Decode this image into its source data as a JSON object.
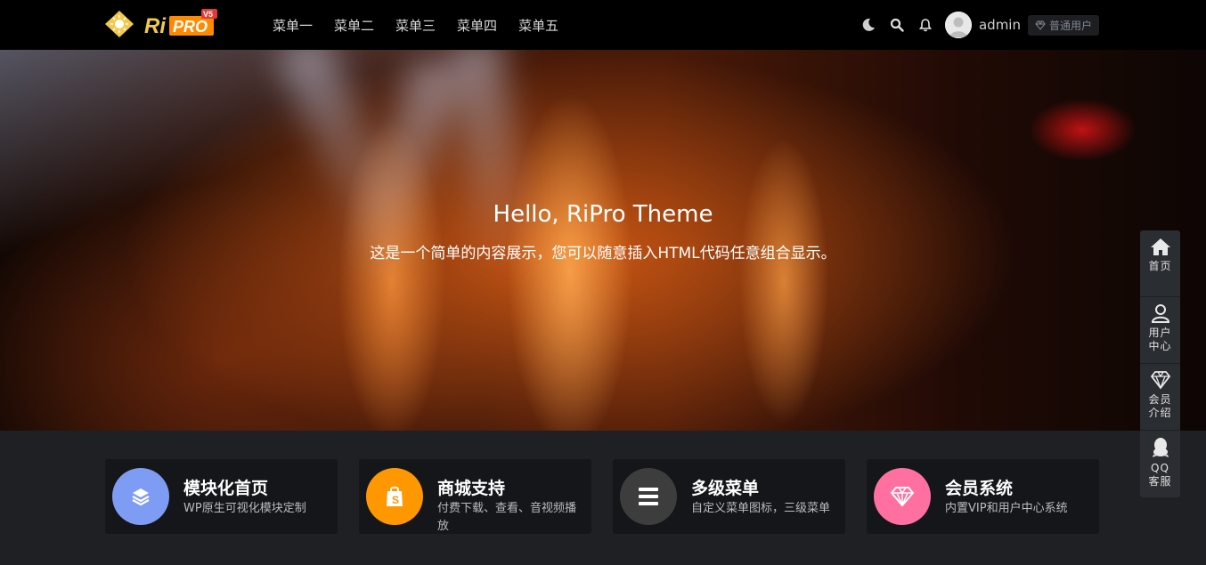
{
  "header": {
    "logo_text": "RiPRO",
    "logo_version": "V5",
    "nav": [
      "菜单一",
      "菜单二",
      "菜单三",
      "菜单四",
      "菜单五"
    ],
    "username": "admin",
    "user_level": "普通用户"
  },
  "hero": {
    "title": "Hello, RiPro Theme",
    "subtitle": "这是一个简单的内容展示，您可以随意插入HTML代码任意组合显示。"
  },
  "features": [
    {
      "title": "模块化首页",
      "desc": "WP原生可视化模块定制",
      "color": "#7f9cf5",
      "icon": "layers-icon"
    },
    {
      "title": "商城支持",
      "desc": "付费下载、查看、音视频播放",
      "color": "#ff9800",
      "icon": "shopify-bag-icon"
    },
    {
      "title": "多级菜单",
      "desc": "自定义菜单图标，三级菜单",
      "color": "#3d3d3d",
      "icon": "list-icon"
    },
    {
      "title": "会员系统",
      "desc": "内置VIP和用户中心系统",
      "color": "#ff6fa0",
      "icon": "diamond-icon"
    }
  ],
  "sidebar": [
    {
      "label": "首页",
      "icon": "home-icon"
    },
    {
      "label": "用户中心",
      "icon": "user-icon"
    },
    {
      "label": "会员介绍",
      "icon": "diamond-icon"
    },
    {
      "label": "QQ客服",
      "icon": "qq-icon"
    }
  ]
}
